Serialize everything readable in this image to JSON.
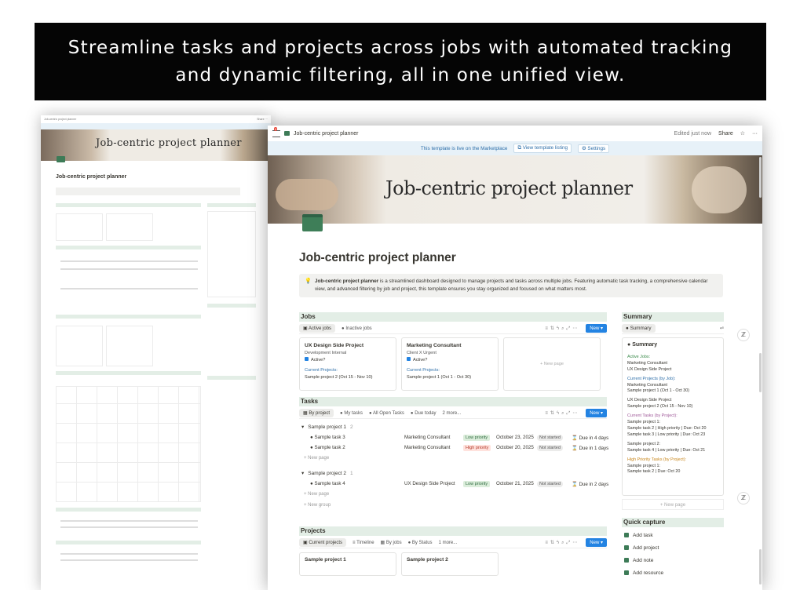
{
  "banner": {
    "text": "Streamline tasks and projects across jobs with automated tracking and dynamic filtering, all in one unified view."
  },
  "back": {
    "title": "Job-centric project planner",
    "cover_title": "Job-centric project planner",
    "topbar": "Job-centric project planner"
  },
  "topbar": {
    "page_name": "Job-centric project planner",
    "notif_count": "9",
    "edited": "Edited just now",
    "share": "Share",
    "star": "☆",
    "more": "···"
  },
  "marketplace": {
    "text": "This template is live on the Marketplace",
    "view_listing": "View template listing",
    "settings": "Settings"
  },
  "cover": {
    "title": "Job-centric project planner"
  },
  "page": {
    "title": "Job-centric project planner",
    "callout_bold": "Job-centric project planner",
    "callout_rest": " is a streamlined dashboard designed to manage projects and tasks across multiple jobs. Featuring automatic task tracking, a comprehensive calendar view, and advanced filtering by job and project, this template ensures you stay organized and focused on what matters most."
  },
  "jobs": {
    "heading": "Jobs",
    "views": [
      "Active jobs",
      "Inactive jobs"
    ],
    "new": "New",
    "cards": [
      {
        "title": "UX Design Side Project",
        "tags": "Development   Internal",
        "active": "Active?",
        "projects_label": "Current Projects:",
        "projects": "Sample project 2 (Oct 15 - Nov 10)"
      },
      {
        "title": "Marketing Consultant",
        "tags": "Client X   Urgent",
        "active": "Active?",
        "projects_label": "Current Projects:",
        "projects": "Sample project 1 (Oct 1 - Oct 30)"
      }
    ],
    "new_page": "+ New page"
  },
  "tasks": {
    "heading": "Tasks",
    "views": [
      "By project",
      "My tasks",
      "All Open Tasks",
      "Due today",
      "2 more..."
    ],
    "new": "New",
    "groups": [
      {
        "name": "Sample project 1",
        "count": "2",
        "rows": [
          {
            "task": "Sample task 3",
            "job": "Marketing Consultant",
            "priority": "Low priority",
            "date": "October 23, 2025",
            "status": "Not started",
            "due": "Due in 4 days"
          },
          {
            "task": "Sample task 2",
            "job": "Marketing Consultant",
            "priority": "High priority",
            "date": "October 20, 2025",
            "status": "Not started",
            "due": "Due in 1 days"
          }
        ]
      },
      {
        "name": "Sample project 2",
        "count": "1",
        "rows": [
          {
            "task": "Sample task 4",
            "job": "UX Design Side Project",
            "priority": "Low priority",
            "date": "October 21, 2025",
            "status": "Not started",
            "due": "Due in 2 days"
          }
        ]
      }
    ],
    "new_page": "+ New page",
    "new_group": "+ New group"
  },
  "projects": {
    "heading": "Projects",
    "views": [
      "Current projects",
      "Timeline",
      "By jobs",
      "By Status",
      "1 more..."
    ],
    "new": "New",
    "cards": [
      "Sample project 1",
      "Sample project 2"
    ]
  },
  "summary": {
    "heading": "Summary",
    "view": "Summary",
    "box_title": "Summary",
    "active_jobs_label": "Active Jobs:",
    "active_jobs": [
      "Marketing Consultant",
      "UX Design Side Project"
    ],
    "current_projects_label": "Current Projects (by Job):",
    "cp1": "Marketing Consultant",
    "cp1_item": "Sample project 1 (Oct 1 - Oct 30)",
    "cp2": "UX Design Side Project",
    "cp2_item": "Sample project 2 (Oct 15 - Nov 10)",
    "current_tasks_label": "Current Tasks (by Project):",
    "ct1": "Sample project 1:",
    "ct1_a": "Sample task 2 | High priority | Due: Oct 20",
    "ct1_b": "Sample task 3 | Low priority | Due: Oct 23",
    "ct2": "Sample project 2:",
    "ct2_a": "Sample task 4 | Low priority | Due: Oct 21",
    "high_label": "High Priority Tasks (by Project):",
    "hp1": "Sample project 1:",
    "hp1_a": "Sample task 2 | Due: Oct 20",
    "new_page": "+ New page"
  },
  "quick_capture": {
    "heading": "Quick capture",
    "items": [
      "Add task",
      "Add project",
      "Add note",
      "Add resource"
    ]
  }
}
